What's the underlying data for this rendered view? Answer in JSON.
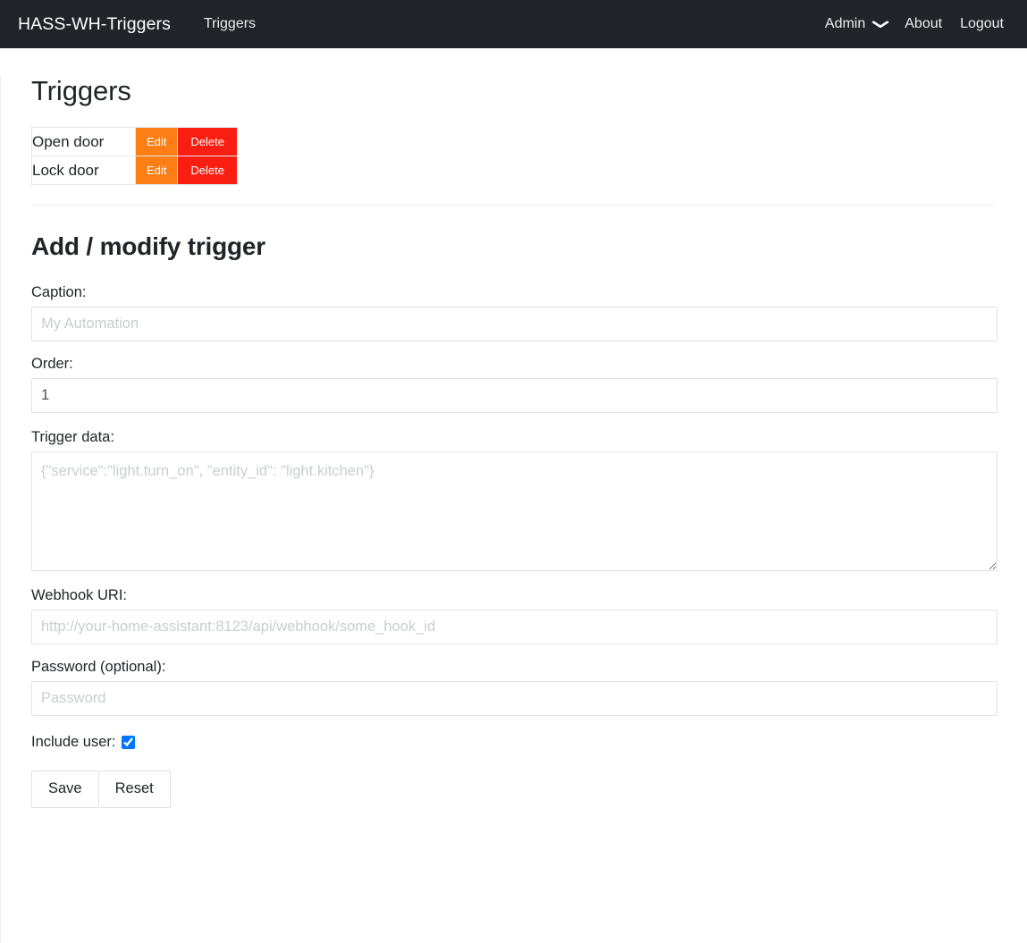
{
  "navbar": {
    "brand": "HASS-WH-Triggers",
    "left_links": [
      {
        "label": "Triggers"
      }
    ],
    "right_links": [
      {
        "label": "Admin",
        "icon": "chevron-down-icon",
        "caret": "❯"
      },
      {
        "label": "About"
      },
      {
        "label": "Logout"
      }
    ],
    "background": "#212529"
  },
  "page": {
    "title": "Triggers",
    "section_title": "Add / modify trigger"
  },
  "triggers_table": {
    "rows": [
      {
        "caption": "Open door",
        "edit_label": "Edit",
        "delete_label": "Delete"
      },
      {
        "caption": "Lock door",
        "edit_label": "Edit",
        "delete_label": "Delete"
      }
    ],
    "edit_color": "#fd7e14",
    "delete_color": "#f81e12"
  },
  "form": {
    "caption": {
      "label": "Caption:",
      "placeholder": "My Automation",
      "value": ""
    },
    "order": {
      "label": "Order:",
      "placeholder": "",
      "value": "1"
    },
    "trigger_data": {
      "label": "Trigger data:",
      "placeholder": "{\"service\":\"light.turn_on\", \"entity_id\": \"light.kitchen\"}",
      "value": ""
    },
    "webhook_uri": {
      "label": "Webhook URI:",
      "placeholder": "http://your-home-assistant:8123/api/webhook/some_hook_id",
      "value": ""
    },
    "password": {
      "label": "Password (optional):",
      "placeholder": "Password",
      "value": ""
    },
    "include_user": {
      "label": "Include user:",
      "checked": true
    },
    "save_label": "Save",
    "reset_label": "Reset"
  }
}
